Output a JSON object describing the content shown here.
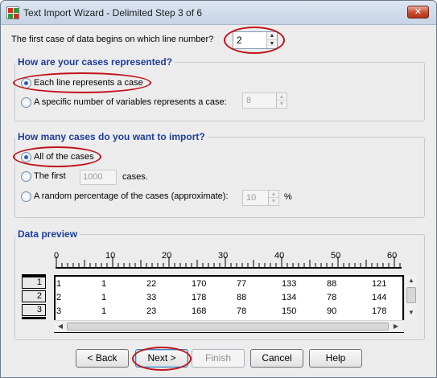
{
  "window": {
    "title": "Text Import Wizard - Delimited Step 3 of 6",
    "close_label": "✕",
    "accent_color": "#c0121a"
  },
  "first_case": {
    "label": "The first case of data begins on which line number?",
    "value": "2"
  },
  "cases_group": {
    "title": "How are your cases represented?",
    "option_each_line": "Each line represents a case",
    "option_specific": "A specific number of variables represents a case:",
    "specific_value": "8",
    "selected": "each_line"
  },
  "import_group": {
    "title": "How many cases do you want to import?",
    "option_all": "All of the cases",
    "option_first": "The first",
    "first_value": "1000",
    "first_suffix": "cases.",
    "option_random": "A random percentage of the cases (approximate):",
    "random_value": "10",
    "random_suffix": "%",
    "selected": "all"
  },
  "preview": {
    "title": "Data preview",
    "ruler_labels": [
      "0",
      "10",
      "20",
      "30",
      "40",
      "50",
      "60"
    ],
    "rows": [
      {
        "num": "1",
        "cells": [
          "1",
          "1",
          "22",
          "170",
          "77",
          "133",
          "88",
          "121"
        ]
      },
      {
        "num": "2",
        "cells": [
          "2",
          "1",
          "33",
          "178",
          "88",
          "134",
          "78",
          "144"
        ]
      },
      {
        "num": "3",
        "cells": [
          "3",
          "1",
          "23",
          "168",
          "78",
          "150",
          "90",
          "178"
        ]
      }
    ]
  },
  "buttons": {
    "back": "< Back",
    "next": "Next >",
    "finish": "Finish",
    "cancel": "Cancel",
    "help": "Help"
  }
}
